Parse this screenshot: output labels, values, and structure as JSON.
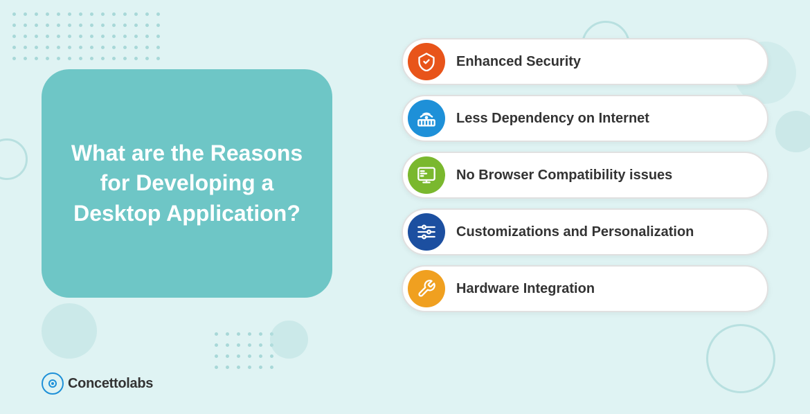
{
  "background_color": "#dff3f3",
  "left_card": {
    "text": "What are the Reasons for Developing a Desktop Application?"
  },
  "features": [
    {
      "id": "enhanced-security",
      "label": "Enhanced Security",
      "icon": "shield",
      "icon_color_class": "icon-orange"
    },
    {
      "id": "less-dependency",
      "label": "Less Dependency on Internet",
      "icon": "wifi",
      "icon_color_class": "icon-blue"
    },
    {
      "id": "no-browser",
      "label": "No Browser Compatibility issues",
      "icon": "monitor",
      "icon_color_class": "icon-green"
    },
    {
      "id": "customization",
      "label": "Customizations and Personalization",
      "icon": "sliders",
      "icon_color_class": "icon-darkblue"
    },
    {
      "id": "hardware",
      "label": "Hardware Integration",
      "icon": "wrench",
      "icon_color_class": "icon-amber"
    }
  ],
  "logo": {
    "text_brand": "oncetto",
    "text_product": "labs"
  }
}
